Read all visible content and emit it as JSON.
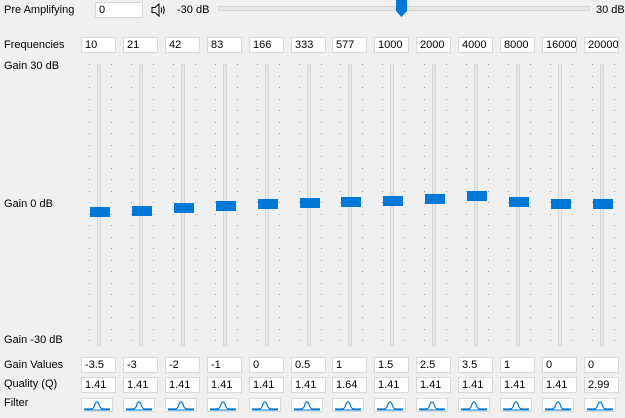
{
  "preamp": {
    "label": "Pre Amplifying",
    "value": "0",
    "min_label": "-30 dB",
    "max_label": "30 dB",
    "speaker_icon": "speaker-icon",
    "level_fraction": 0.5
  },
  "rows": {
    "frequencies_label": "Frequencies",
    "gain_top_label": "Gain 30 dB",
    "gain_mid_label": "Gain 0 dB",
    "gain_bottom_label": "Gain -30 dB",
    "gain_values_label": "Gain Values",
    "quality_label": "Quality (Q)",
    "filter_label": "Filter"
  },
  "gain_range": [
    -30,
    30
  ],
  "accent_color": "#0078d7",
  "filter_icon": "peaking-filter-icon",
  "bands": [
    {
      "freq": "10",
      "gain": "-3.5",
      "q": "1.41"
    },
    {
      "freq": "21",
      "gain": "-3",
      "q": "1.41"
    },
    {
      "freq": "42",
      "gain": "-2",
      "q": "1.41"
    },
    {
      "freq": "83",
      "gain": "-1",
      "q": "1.41"
    },
    {
      "freq": "166",
      "gain": "0",
      "q": "1.41"
    },
    {
      "freq": "333",
      "gain": "0.5",
      "q": "1.41"
    },
    {
      "freq": "577",
      "gain": "1",
      "q": "1.64"
    },
    {
      "freq": "1000",
      "gain": "1.5",
      "q": "1.41"
    },
    {
      "freq": "2000",
      "gain": "2.5",
      "q": "1.41"
    },
    {
      "freq": "4000",
      "gain": "3.5",
      "q": "1.41"
    },
    {
      "freq": "8000",
      "gain": "1",
      "q": "1.41"
    },
    {
      "freq": "16000",
      "gain": "0",
      "q": "1.41"
    },
    {
      "freq": "20000",
      "gain": "0",
      "q": "2.99"
    }
  ]
}
